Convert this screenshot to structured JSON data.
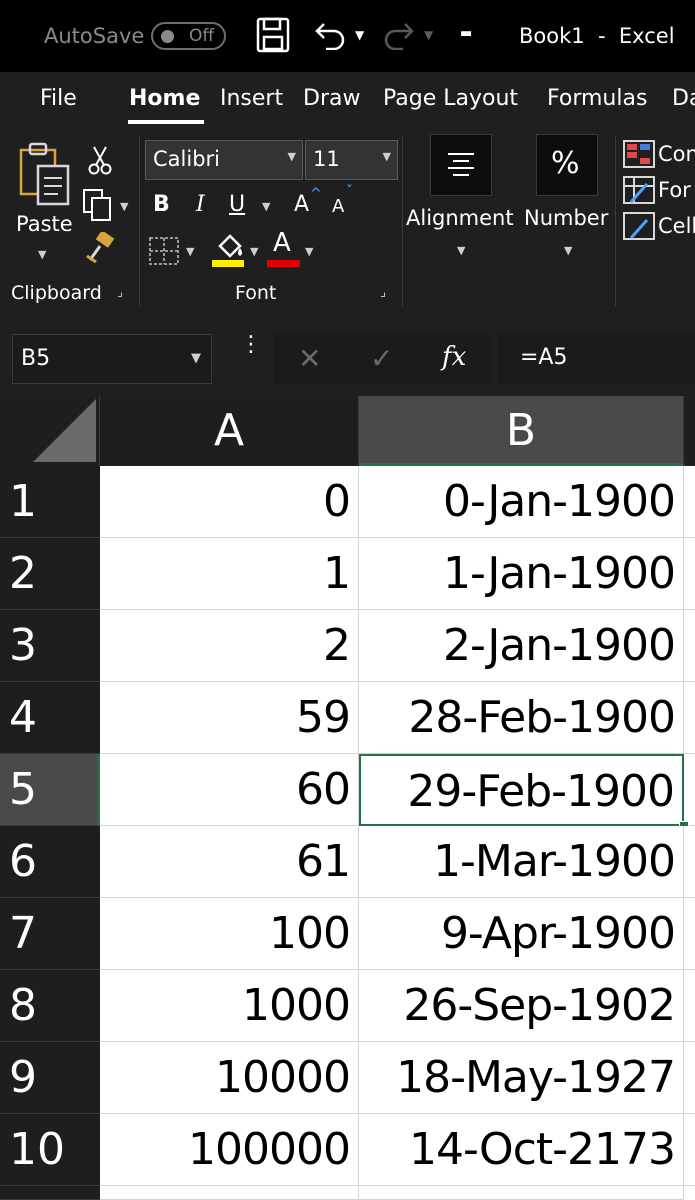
{
  "titlebar": {
    "autosave_label": "AutoSave",
    "autosave_state": "Off",
    "title": "Book1  -  Excel"
  },
  "ribbon": {
    "tabs": [
      "File",
      "Home",
      "Insert",
      "Draw",
      "Page Layout",
      "Formulas",
      "Da"
    ],
    "active_tab": "Home",
    "clipboard": {
      "paste_label": "Paste",
      "group_label": "Clipboard"
    },
    "font": {
      "name": "Calibri",
      "size": "11",
      "group_label": "Font",
      "bold": "B",
      "italic": "I",
      "underline": "U",
      "grow": "A",
      "shrink": "A",
      "font_color_glyph": "A",
      "highlight_color": "#ffee00",
      "font_color": "#e00000"
    },
    "alignment": {
      "label": "Alignment"
    },
    "number": {
      "label": "Number",
      "glyph": "%"
    },
    "styles": [
      "Con",
      "For",
      "Cell"
    ]
  },
  "formula_bar": {
    "name_box": "B5",
    "fx": "fx",
    "formula": "=A5"
  },
  "sheet": {
    "columns": [
      "A",
      "B"
    ],
    "selected_column": "B",
    "selected_row": 5,
    "rows": [
      {
        "num": "1",
        "a": "0",
        "b": "0-Jan-1900"
      },
      {
        "num": "2",
        "a": "1",
        "b": "1-Jan-1900"
      },
      {
        "num": "3",
        "a": "2",
        "b": "2-Jan-1900"
      },
      {
        "num": "4",
        "a": "59",
        "b": "28-Feb-1900"
      },
      {
        "num": "5",
        "a": "60",
        "b": "29-Feb-1900"
      },
      {
        "num": "6",
        "a": "61",
        "b": "1-Mar-1900"
      },
      {
        "num": "7",
        "a": "100",
        "b": "9-Apr-1900"
      },
      {
        "num": "8",
        "a": "1000",
        "b": "26-Sep-1902"
      },
      {
        "num": "9",
        "a": "10000",
        "b": "18-May-1927"
      },
      {
        "num": "10",
        "a": "100000",
        "b": "14-Oct-2173"
      }
    ]
  },
  "colors": {
    "selection": "#217346",
    "ribbon_bg": "#1f1f1f",
    "title_bg": "#000000"
  }
}
